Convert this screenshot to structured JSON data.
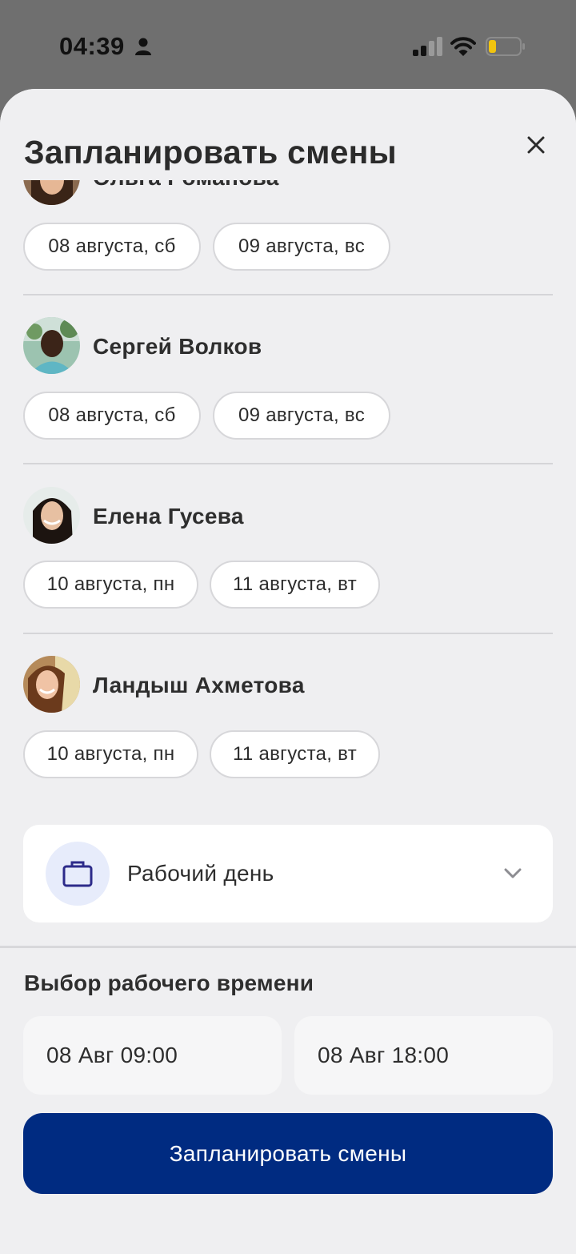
{
  "status_bar": {
    "time": "04:39"
  },
  "sheet": {
    "title": "Запланировать смены",
    "close_icon": "close-icon"
  },
  "employees": [
    {
      "name": "Ольга Романова",
      "dates": [
        "08 августа, сб",
        "09 августа, вс"
      ]
    },
    {
      "name": "Сергей Волков",
      "dates": [
        "08 августа, сб",
        "09 августа, вс"
      ]
    },
    {
      "name": "Елена Гусева",
      "dates": [
        "10 августа, пн",
        "11 августа, вт"
      ]
    },
    {
      "name": "Ландыш Ахметова",
      "dates": [
        "10 августа, пн",
        "11 августа, вт"
      ]
    }
  ],
  "shift_type": {
    "label": "Рабочий день",
    "icon": "briefcase-icon"
  },
  "work_time": {
    "title": "Выбор рабочего времени",
    "start": "08 Авг 09:00",
    "end": "08 Авг 18:00"
  },
  "submit_label": "Запланировать смены",
  "colors": {
    "primary": "#002b81",
    "sheet_bg": "#efeff1",
    "icon_accent": "#2d2b8a",
    "battery": "#f1c40f"
  }
}
